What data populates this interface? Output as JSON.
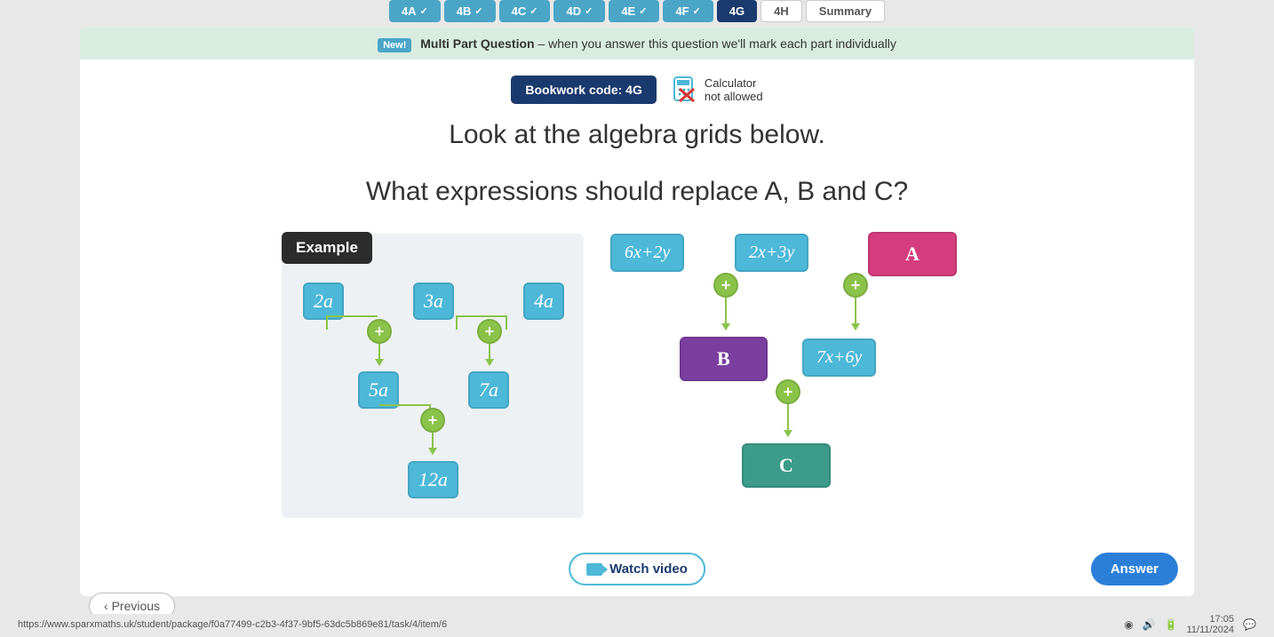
{
  "tabs": {
    "items": [
      {
        "label": "4A",
        "done": true
      },
      {
        "label": "4B",
        "done": true
      },
      {
        "label": "4C",
        "done": true
      },
      {
        "label": "4D",
        "done": true
      },
      {
        "label": "4E",
        "done": true
      },
      {
        "label": "4F",
        "done": true
      }
    ],
    "active": "4G",
    "inactive1": "4H",
    "inactive2": "Summary"
  },
  "banner": {
    "new": "New!",
    "bold": "Multi Part Question",
    "rest": " – when you answer this question we'll mark each part individually"
  },
  "bookwork": "Bookwork code: 4G",
  "calculator": {
    "line1": "Calculator",
    "line2": "not allowed"
  },
  "question": {
    "line1": "Look at the algebra grids below.",
    "line2": "What expressions should replace A, B and C?"
  },
  "example": {
    "label": "Example",
    "top": [
      "2a",
      "3a",
      "4a"
    ],
    "mid": [
      "5a",
      "7a"
    ],
    "bottom": "12a"
  },
  "problem": {
    "top": [
      "6x+2y",
      "2x+3y",
      "A"
    ],
    "mid": [
      "B",
      "7x+6y"
    ],
    "bottom": "C"
  },
  "plus": "+",
  "watch_video": "Watch video",
  "answer": "Answer",
  "previous": "Previous",
  "status": {
    "url": "https://www.sparxmaths.uk/student/package/f0a77499-c2b3-4f37-9bf5-63dc5b869e81/task/4/item/6",
    "time": "17:05",
    "date": "11/11/2024"
  }
}
